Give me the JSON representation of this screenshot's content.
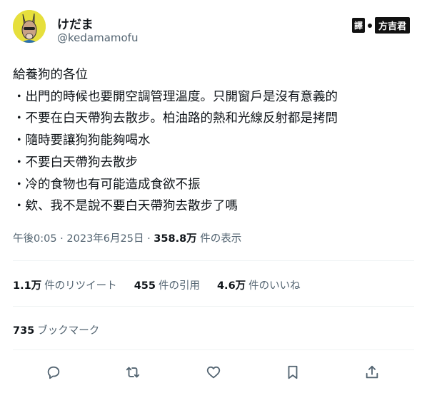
{
  "user": {
    "display_name": "けだま",
    "handle": "@kedamamofu",
    "avatar_icon": "kangaroo-avatar-icon"
  },
  "watermark": {
    "badge": "譯",
    "text": "方吉君"
  },
  "tweet": {
    "lines": [
      "給養狗的各位",
      "・出門的時候也要開空調管理溫度。只開窗戶是沒有意義的",
      "・不要在白天帶狗去散步。柏油路的熱和光線反射都是拷問",
      "・隨時要讓狗狗能夠喝水",
      "・不要白天帶狗去散步",
      "・冷的食物也有可能造成食欲不振",
      "・欸、我不是說不要白天帶狗去散步了嗎"
    ]
  },
  "meta": {
    "time": "午後0:05 · 2023年6月25日 · ",
    "views": "358.8万",
    "views_label": " 件の表示"
  },
  "stats": {
    "retweets_count": "1.1万",
    "retweets_label": "件のリツイート",
    "quotes_count": "455",
    "quotes_label": "件の引用",
    "likes_count": "4.6万",
    "likes_label": "件のいいね"
  },
  "bookmarks": {
    "count": "735",
    "label": "ブックマーク"
  },
  "actions": [
    "reply-icon",
    "retweet-icon",
    "like-icon",
    "bookmark-icon",
    "share-icon"
  ]
}
